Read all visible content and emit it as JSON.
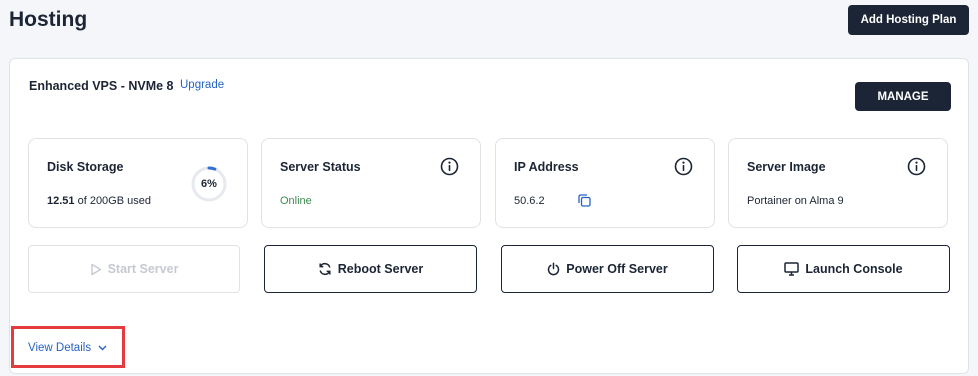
{
  "page": {
    "title": "Hosting",
    "add_plan_label": "Add Hosting Plan"
  },
  "plan": {
    "name": "Enhanced VPS - NVMe 8",
    "upgrade_label": "Upgrade",
    "manage_label": "MANAGE"
  },
  "stats": {
    "disk": {
      "title": "Disk Storage",
      "used": "12.51",
      "of_label": "of 200GB used",
      "percent_label": "6%",
      "percent": 0.06
    },
    "status": {
      "title": "Server Status",
      "value": "Online"
    },
    "ip": {
      "title": "IP Address",
      "value": "50.6.2"
    },
    "image": {
      "title": "Server Image",
      "value": "Portainer on Alma 9"
    }
  },
  "actions": {
    "start": "Start Server",
    "reboot": "Reboot Server",
    "power_off": "Power Off Server",
    "console": "Launch Console"
  },
  "details": {
    "label": "View Details"
  },
  "colors": {
    "primary": "#1c2535",
    "link": "#2463c4",
    "online": "#3f8a52",
    "gauge": "#2f6fd6",
    "highlight": "#e53a3e"
  },
  "icons": {
    "info": "info-icon",
    "copy": "copy-icon",
    "play": "play-icon",
    "refresh": "refresh-icon",
    "power": "power-icon",
    "monitor": "monitor-icon",
    "chevron": "chevron-down-icon"
  }
}
